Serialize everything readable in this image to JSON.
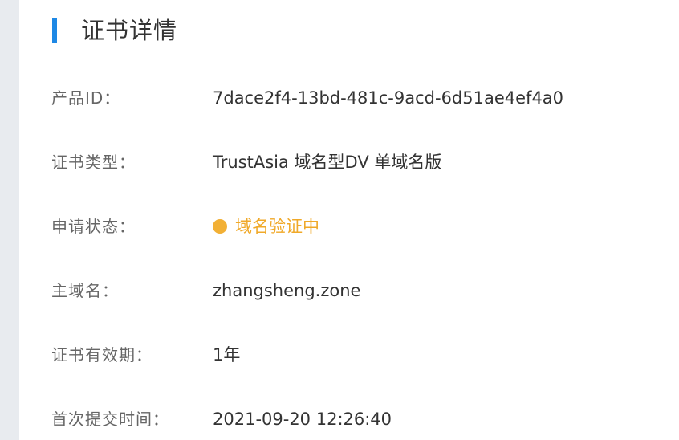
{
  "section": {
    "title": "证书详情"
  },
  "details": [
    {
      "label": "产品ID：",
      "value": "7dace2f4-13bd-481c-9acd-6d51ae4ef4a0"
    },
    {
      "label": "证书类型：",
      "value": "TrustAsia 域名型DV 单域名版"
    },
    {
      "label": "申请状态：",
      "value": "域名验证中"
    },
    {
      "label": "主域名：",
      "value": "zhangsheng.zone"
    },
    {
      "label": "证书有效期：",
      "value": "1年"
    },
    {
      "label": "首次提交时间：",
      "value": "2021-09-20 12:26:40"
    }
  ],
  "colors": {
    "accent": "#1e88e5",
    "status_pending": "#f0a929"
  }
}
